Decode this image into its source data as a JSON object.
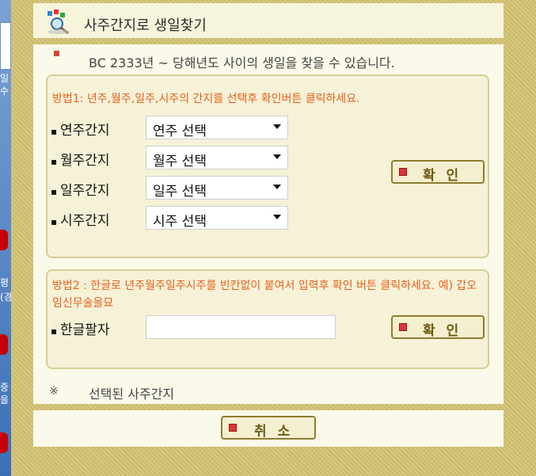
{
  "window": {
    "title": "사주간지로 생일찾기"
  },
  "intro": "BC 2333년 ~ 당해년도 사이의 생일을 찾을 수 있습니다.",
  "method1": {
    "title": "방법1: 년주,월주,일주,시주의 간지를 선택후 확인버튼 클릭하세요.",
    "rows": [
      {
        "label": "연주간지",
        "selected": "연주 선택"
      },
      {
        "label": "월주간지",
        "selected": "월주 선택"
      },
      {
        "label": "일주간지",
        "selected": "일주 선택"
      },
      {
        "label": "시주간지",
        "selected": "시주 선택"
      }
    ],
    "confirm_label": "확 인"
  },
  "method2": {
    "title": "방법2 : 한글로 년주월주일주시주를 빈칸없이 붙여서 입력후 확인 버튼 클릭하세요. 예) 갑오임신무술을묘",
    "label": "한글팔자",
    "value": "",
    "confirm_label": "확 인"
  },
  "selected": {
    "mark": "※",
    "label": "선택된 사주간지"
  },
  "footer": {
    "cancel_label": "취 소"
  },
  "colors": {
    "accent": "#e8601c",
    "panel_border": "#d6cd95",
    "button_text": "#6b5a12"
  },
  "sidebar": {
    "texts": [
      "일",
      "수",
      "평",
      "(경",
      "중",
      "을"
    ]
  }
}
